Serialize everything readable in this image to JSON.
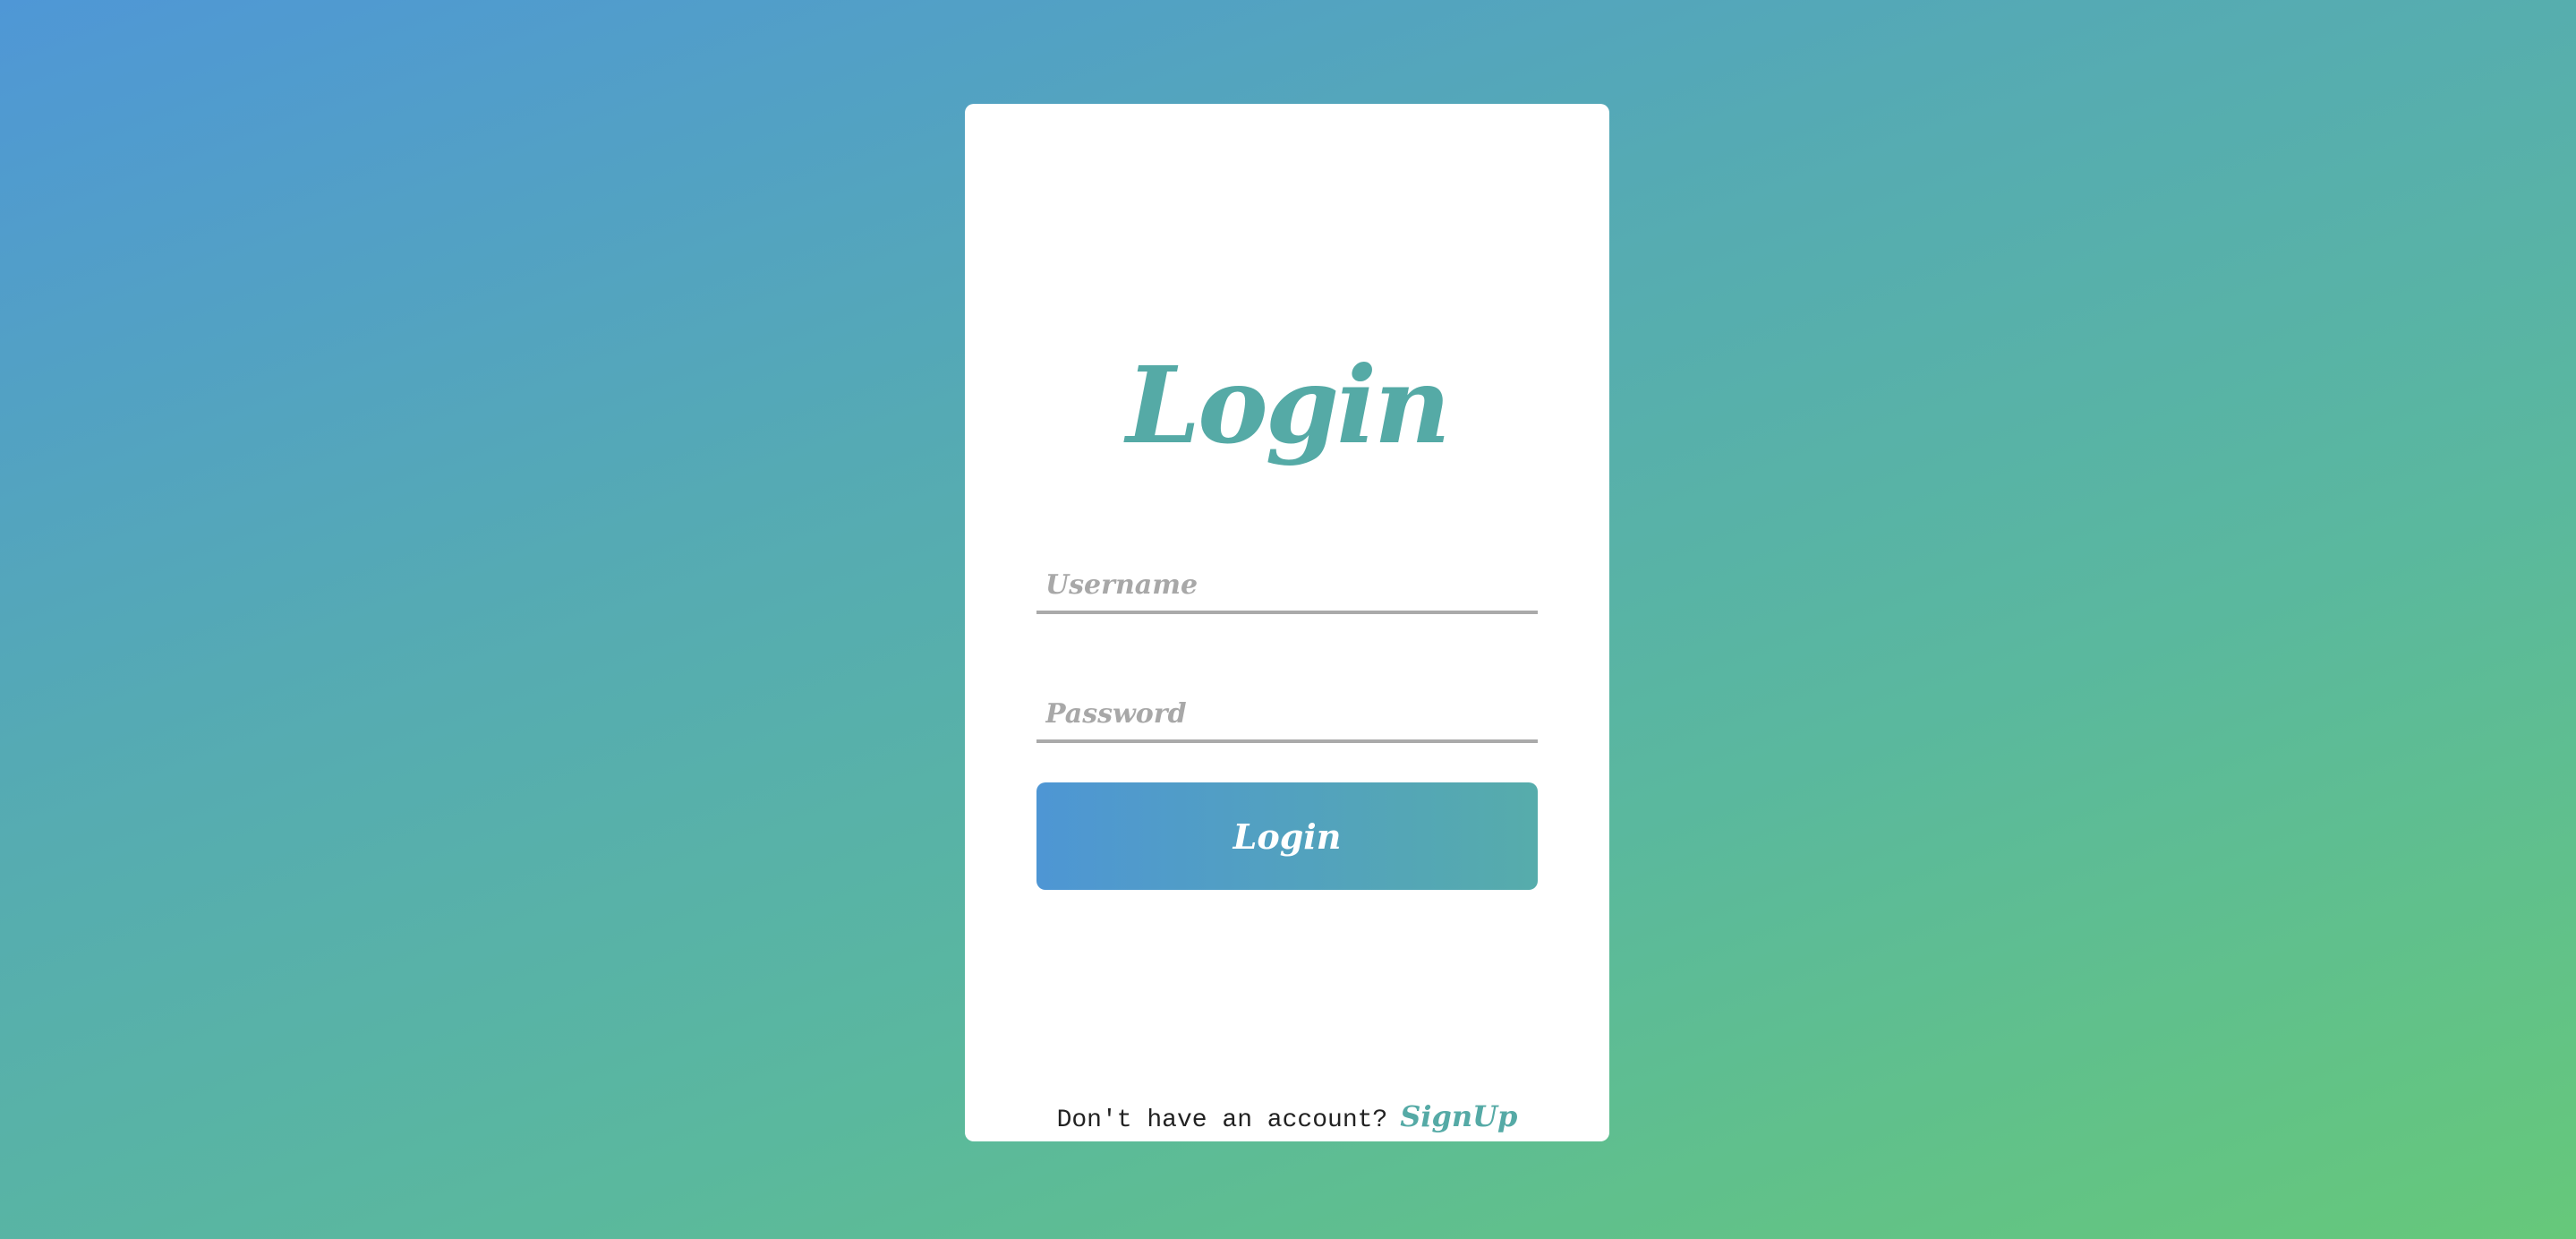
{
  "login_card": {
    "title": "Login",
    "username_placeholder": "Username",
    "password_placeholder": "Password",
    "submit_label": "Login",
    "footer_text": "Don't have an account?",
    "signup_label": "SignUp"
  },
  "colors": {
    "accent": "#55aaa6",
    "gradient_start": "#4f97d6",
    "gradient_end": "#66c87a"
  }
}
